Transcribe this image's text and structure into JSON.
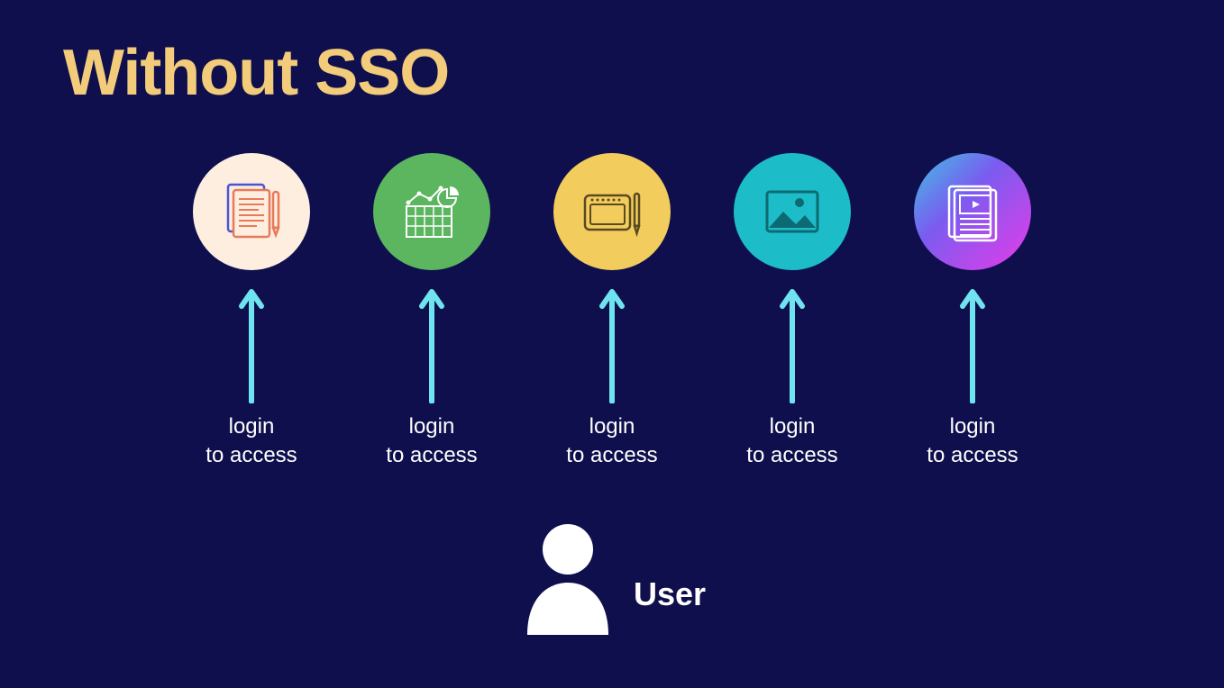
{
  "title": "Without SSO",
  "apps": [
    {
      "icon": "documents-pen-icon",
      "label": "login\nto access",
      "color": "#fdeee0"
    },
    {
      "icon": "analytics-chart-icon",
      "label": "login\nto access",
      "color": "#5bb65f"
    },
    {
      "icon": "drawing-tablet-icon",
      "label": "login\nto access",
      "color": "#f2cc5c"
    },
    {
      "icon": "image-photo-icon",
      "label": "login\nto access",
      "color": "#1dbcc9"
    },
    {
      "icon": "media-player-icon",
      "label": "login\nto access",
      "color": "gradient"
    }
  ],
  "user_label": "User",
  "colors": {
    "background": "#0f0f4d",
    "title": "#f2cc7a",
    "arrow": "#6fe3ef",
    "text": "#ffffff"
  }
}
